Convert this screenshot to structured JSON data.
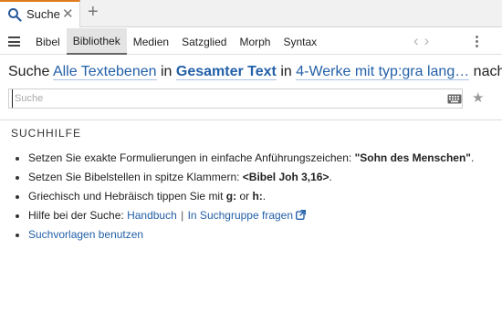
{
  "tab": {
    "label": "Suche",
    "new_tab": "+"
  },
  "toolbar": {
    "menu": [
      {
        "label": "Bibel",
        "active": false
      },
      {
        "label": "Bibliothek",
        "active": true
      },
      {
        "label": "Medien",
        "active": false
      },
      {
        "label": "Satzglied",
        "active": false
      },
      {
        "label": "Morph",
        "active": false
      },
      {
        "label": "Syntax",
        "active": false
      }
    ],
    "back_arrow": "‹",
    "forward_arrow": "›"
  },
  "search": {
    "sentence": {
      "prefix": "Suche",
      "text_levels": "Alle Textebenen",
      "in1": "in",
      "scope": "Gesamter Text",
      "in2": "in",
      "collection": "4-Werke mit typ:gra lang…",
      "suffix": "nach"
    },
    "input": {
      "value": "",
      "placeholder": "Suche"
    }
  },
  "help": {
    "title": "SUCHHILFE",
    "items": {
      "quotes": {
        "text": "Setzen Sie exakte Formulierungen in einfache Anführungszeichen: ",
        "example": "\"Sohn des Menschen\"",
        "end": "."
      },
      "refs": {
        "text": "Setzen Sie Bibelstellen in spitze Klammern: ",
        "example": "<Bibel Joh 3,16>",
        "end": "."
      },
      "languages": {
        "text": "Griechisch und Hebräisch tippen Sie mit ",
        "g": "g:",
        "or": " or ",
        "h": "h:",
        "end": "."
      },
      "support": {
        "text": "Hilfe bei der Suche: ",
        "manual": "Handbuch",
        "sep": "|",
        "group": "In Suchgruppe fragen"
      },
      "templates": {
        "link": "Suchvorlagen benutzen"
      }
    }
  },
  "colors": {
    "accent": "#e07b20",
    "link": "#2360a8"
  },
  "icons": [
    "search-icon",
    "close-icon",
    "plus-icon",
    "hamburger-icon",
    "chevron-left-icon",
    "chevron-right-icon",
    "kebab-icon",
    "keyboard-icon",
    "star-icon",
    "external-link-icon"
  ]
}
